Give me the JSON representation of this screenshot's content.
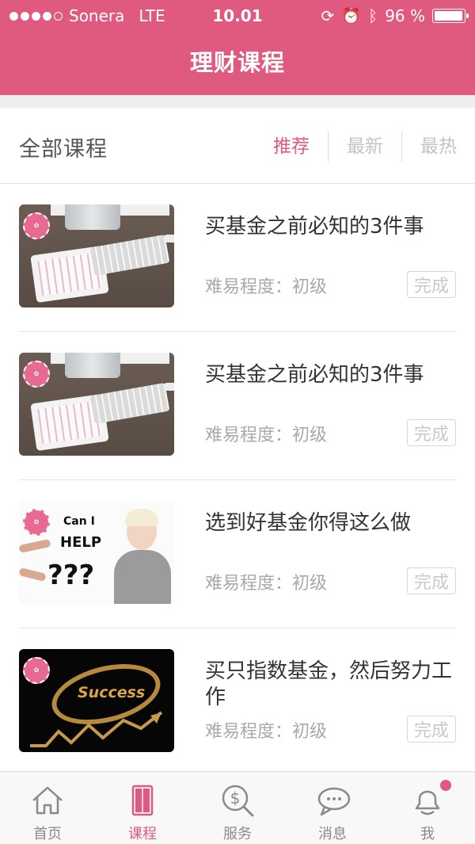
{
  "status_bar": {
    "carrier": "Sonera",
    "network": "LTE",
    "time": "10.01",
    "battery_text": "96 %",
    "battery_level": 0.96
  },
  "nav": {
    "title": "理财课程"
  },
  "filter": {
    "all_label": "全部课程",
    "tabs": [
      {
        "label": "推荐",
        "active": true
      },
      {
        "label": "最新",
        "active": false
      },
      {
        "label": "最热",
        "active": false
      }
    ]
  },
  "courses": [
    {
      "title": "买基金之前必知的3件事",
      "difficulty": "难易程度：初级",
      "status": "完成",
      "image": "desk-keyboard-calendar"
    },
    {
      "title": "买基金之前必知的3件事",
      "difficulty": "难易程度：初级",
      "status": "完成",
      "image": "desk-keyboard-calendar"
    },
    {
      "title": "选到好基金你得这么做",
      "difficulty": "难易程度：初级",
      "status": "完成",
      "image": "can-i-help"
    },
    {
      "title": "买只指数基金，然后努力工作",
      "difficulty": "难易程度：初级",
      "status": "完成",
      "image": "success-arrow"
    }
  ],
  "thumb_text": {
    "help_can": "Can I",
    "help_word": "HELP",
    "help_q": "???",
    "success_word": "Success"
  },
  "tab_bar": {
    "items": [
      {
        "label": "首页",
        "icon": "home-icon",
        "active": false
      },
      {
        "label": "课程",
        "icon": "book-icon",
        "active": true
      },
      {
        "label": "服务",
        "icon": "dollar-search-icon",
        "active": false
      },
      {
        "label": "消息",
        "icon": "chat-bubbles-icon",
        "active": false
      },
      {
        "label": "我",
        "icon": "user-icon",
        "active": false,
        "badge": true
      }
    ]
  },
  "colors": {
    "brand": "#e05a80",
    "muted": "#a9a9a9"
  }
}
